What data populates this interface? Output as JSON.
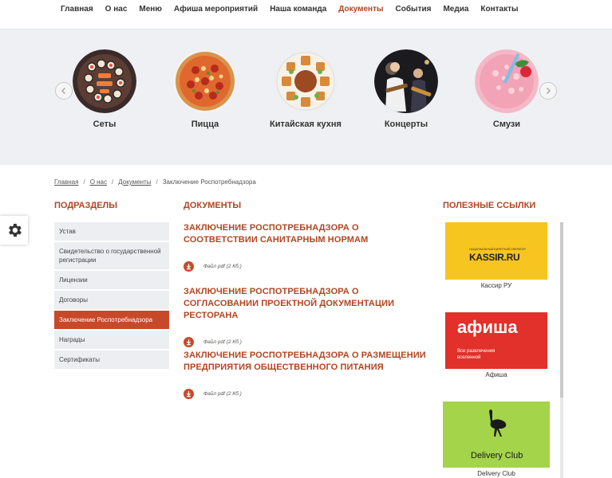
{
  "nav": {
    "items": [
      "Главная",
      "О нас",
      "Меню",
      "Афиша мероприятий",
      "Наша команда",
      "Документы",
      "События",
      "Медиа",
      "Контакты"
    ],
    "active_index": 5
  },
  "carousel": {
    "items": [
      {
        "label": "Сеты"
      },
      {
        "label": "Пицца"
      },
      {
        "label": "Китайская кухня"
      },
      {
        "label": "Концерты"
      },
      {
        "label": "Смузи"
      }
    ]
  },
  "breadcrumb": {
    "items": [
      "Главная",
      "О нас",
      "Документы"
    ],
    "current": "Заключение Роспотребнадзора",
    "separator": "/"
  },
  "sidebar": {
    "title": "ПОДРАЗДЕЛЫ",
    "items": [
      "Устав",
      "Свидетельство о государственной регистрации",
      "Лицензии",
      "Договоры",
      "Заключение Роспотребнадзора",
      "Награды",
      "Сертификаты"
    ],
    "active_index": 4
  },
  "documents": {
    "title": "ДОКУМЕНТЫ",
    "items": [
      {
        "title": "ЗАКЛЮЧЕНИЕ РОСПОТРЕБНАДЗОРА О СООТВЕТСТВИИ САНИТАРНЫМ НОРМАМ",
        "file": "Файл pdf (2 Кб.)"
      },
      {
        "title": "ЗАКЛЮЧЕНИЕ РОСПОТРЕБНАДЗОРА О СОГЛАСОВАНИИ ПРОЕКТНОЙ ДОКУМЕНТАЦИИ РЕСТОРАНА",
        "file": "Файл pdf (2 Кб.)"
      },
      {
        "title": "ЗАКЛЮЧЕНИЕ РОСПОТРЕБНАДЗОРА О РАЗМЕЩЕНИИ ПРЕДПРИЯТИЯ ОБЩЕСТВЕННОГО ПИТАНИЯ",
        "file": "Файл pdf (2 Кб.)"
      }
    ]
  },
  "links": {
    "title": "ПОЛЕЗНЫЕ ССЫЛКИ",
    "items": [
      {
        "caption": "Кассир РУ",
        "logo_top": "НАЦИОНАЛЬНЫЙ БИЛЕТНЫЙ ОПЕРАТОР",
        "logo_text": "KASSIR.RU",
        "bg": "#f7c51f"
      },
      {
        "caption": "Афиша",
        "logo_text": "афиша",
        "logo_sub": "Все развлечения вселенной",
        "bg": "#e2302a"
      },
      {
        "caption": "Delivery Club",
        "logo_text": "Delivery Club",
        "bg": "#a3d44a"
      }
    ]
  },
  "colors": {
    "accent": "#b24521",
    "active_bg": "#c8492a",
    "carousel_bg": "#eff0f4"
  },
  "icons": {
    "settings": "gear-icon",
    "download": "download-icon",
    "prev": "chevron-left-icon",
    "next": "chevron-right-icon"
  }
}
